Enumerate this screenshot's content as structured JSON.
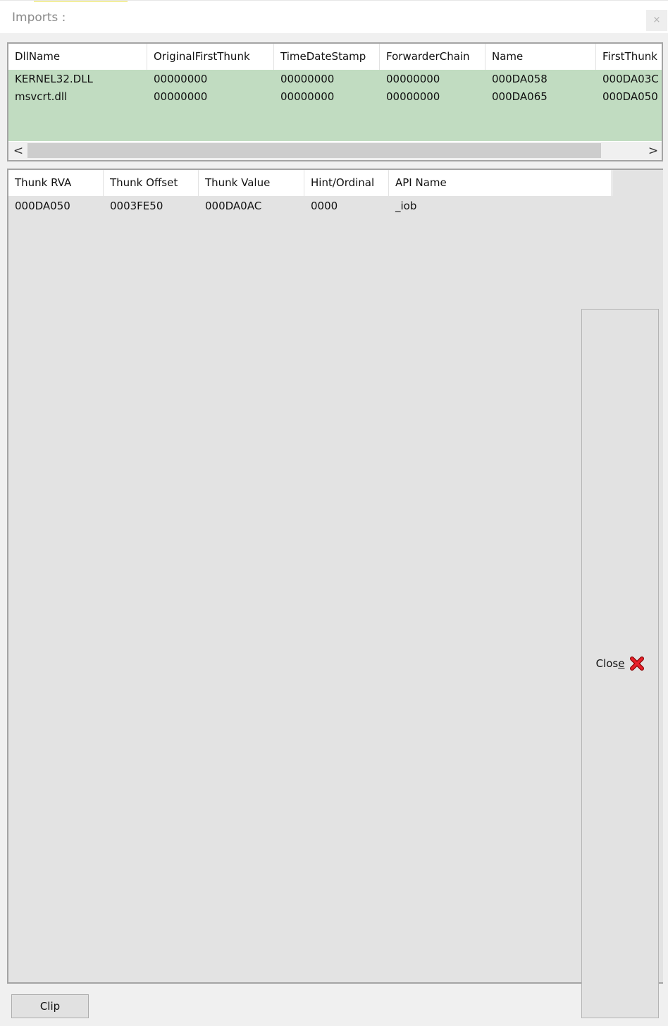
{
  "window": {
    "title": "Imports :",
    "close_glyph": "×"
  },
  "dll_table": {
    "columns": [
      "DllName",
      "OriginalFirstThunk",
      "TimeDateStamp",
      "ForwarderChain",
      "Name",
      "FirstThunk"
    ],
    "rows": [
      [
        "KERNEL32.DLL",
        "00000000",
        "00000000",
        "00000000",
        "000DA058",
        "000DA03C"
      ],
      [
        "msvcrt.dll",
        "00000000",
        "00000000",
        "00000000",
        "000DA065",
        "000DA050"
      ]
    ],
    "selected_row_color": "#c1dcc1",
    "scroll_left_glyph": "<",
    "scroll_right_glyph": ">"
  },
  "thunk_table": {
    "columns": [
      "Thunk RVA",
      "Thunk Offset",
      "Thunk Value",
      "Hint/Ordinal",
      "API Name"
    ],
    "rows": [
      [
        "000DA050",
        "0003FE50",
        "000DA0AC",
        "0000",
        "_iob"
      ]
    ]
  },
  "buttons": {
    "close_prefix": "Clos",
    "close_mnemonic": "e",
    "close_icon": "red-x-icon",
    "clip_label": "Clip"
  }
}
